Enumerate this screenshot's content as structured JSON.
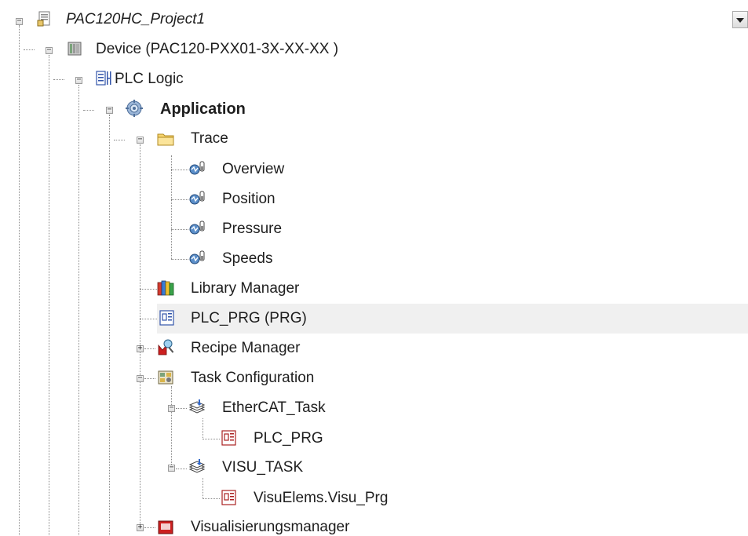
{
  "tree": {
    "project": {
      "label": "PAC120HC_Project1",
      "icon": "project-file-icon"
    },
    "device": {
      "label": "Device (PAC120-PXX01-3X-XX-XX )",
      "icon": "device-icon"
    },
    "plc_logic": {
      "label": "PLC Logic",
      "icon": "plc-logic-icon"
    },
    "application": {
      "label": "Application",
      "icon": "application-gear-icon"
    },
    "trace": {
      "label": "Trace",
      "icon": "folder-icon"
    },
    "trace_items": [
      {
        "label": "Overview",
        "icon": "trace-icon"
      },
      {
        "label": "Position",
        "icon": "trace-icon"
      },
      {
        "label": "Pressure",
        "icon": "trace-icon"
      },
      {
        "label": "Speeds",
        "icon": "trace-icon"
      }
    ],
    "library_manager": {
      "label": "Library Manager",
      "icon": "library-books-icon"
    },
    "plc_prg": {
      "label": "PLC_PRG (PRG)",
      "icon": "program-pou-icon"
    },
    "recipe_manager": {
      "label": "Recipe Manager",
      "icon": "recipe-manager-icon"
    },
    "task_configuration": {
      "label": "Task Configuration",
      "icon": "task-configuration-icon"
    },
    "ethercat_task": {
      "label": "EtherCAT_Task",
      "icon": "task-icon"
    },
    "ethercat_call": {
      "label": "PLC_PRG",
      "icon": "program-call-icon"
    },
    "visu_task": {
      "label": "VISU_TASK",
      "icon": "task-icon"
    },
    "visu_call": {
      "label": "VisuElems.Visu_Prg",
      "icon": "program-call-icon"
    },
    "visualisierungsmanager": {
      "label": "Visualisierungsmanager",
      "icon": "visualization-manager-icon"
    }
  },
  "expander_symbols": {
    "expanded": "−",
    "collapsed": "+"
  },
  "colors": {
    "selection_row": "#f0f0f0",
    "tree_lines": "#8a8a8a",
    "text": "#1e1e1e"
  }
}
